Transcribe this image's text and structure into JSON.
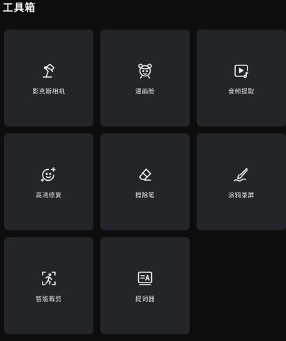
{
  "header": {
    "title": "工具箱"
  },
  "tools": [
    {
      "label": "影克斯相机",
      "icon": "desk-lamp-icon"
    },
    {
      "label": "漫画脸",
      "icon": "cartoon-face-icon"
    },
    {
      "label": "音频提取",
      "icon": "audio-extract-icon"
    },
    {
      "label": "高清修复",
      "icon": "sparkle-face-icon"
    },
    {
      "label": "擦除笔",
      "icon": "eraser-icon"
    },
    {
      "label": "涂鸦录屏",
      "icon": "brush-doodle-icon"
    },
    {
      "label": "智能裁剪",
      "icon": "smart-crop-icon"
    },
    {
      "label": "提词器",
      "icon": "teleprompter-icon"
    }
  ]
}
